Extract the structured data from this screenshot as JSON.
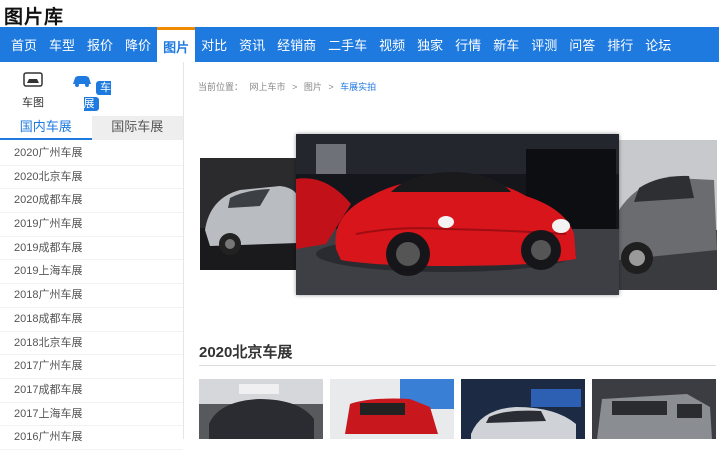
{
  "page_title": "图片库",
  "nav": [
    "首页",
    "车型",
    "报价",
    "降价",
    "图片",
    "对比",
    "资讯",
    "经销商",
    "二手车",
    "视频",
    "独家",
    "行情",
    "新车",
    "评测",
    "问答",
    "排行",
    "论坛"
  ],
  "nav_active_index": 4,
  "categories": [
    {
      "label": "车图",
      "icon": "car-photo-icon"
    },
    {
      "label": "车展",
      "icon": "car-show-icon"
    }
  ],
  "tabs": {
    "domestic": "国内车展",
    "international": "国际车展"
  },
  "shows": [
    "2020广州车展",
    "2020北京车展",
    "2020成都车展",
    "2019广州车展",
    "2019成都车展",
    "2019上海车展",
    "2018广州车展",
    "2018成都车展",
    "2018北京车展",
    "2017广州车展",
    "2017成都车展",
    "2017上海车展",
    "2016广州车展"
  ],
  "breadcrumb": {
    "label": "当前位置：",
    "items": [
      "网上车市",
      ">",
      "图片",
      ">"
    ],
    "current": "车展实拍"
  },
  "section_title": "2020北京车展",
  "colors": {
    "brand_blue": "#1f7ae0",
    "accent_orange": "#f08a00"
  }
}
